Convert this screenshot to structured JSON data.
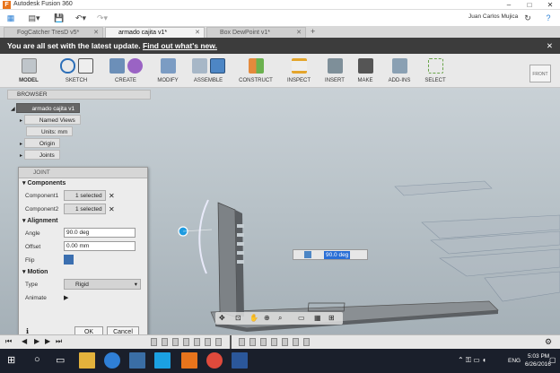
{
  "window": {
    "title": "Autodesk Fusion 360",
    "logo": "F"
  },
  "user": {
    "name": "Juan Carlos Mujica"
  },
  "tabs": [
    {
      "label": "FogCatcher TresD v5*"
    },
    {
      "label": "armado cajita v1*"
    },
    {
      "label": "Box DewPoint v1*"
    }
  ],
  "notification": {
    "text": "You are all set with the latest update.",
    "link": "Find out what's new."
  },
  "toolbar": {
    "model": "MODEL",
    "groups": [
      "SKETCH",
      "CREATE",
      "MODIFY",
      "ASSEMBLE",
      "CONSTRUCT",
      "INSPECT",
      "INSERT",
      "MAKE",
      "ADD-INS",
      "SELECT"
    ],
    "viewcube": "FRONT"
  },
  "browser": {
    "title": "BROWSER",
    "root": "armado cajita v1",
    "items": [
      "Named Views",
      "Units: mm",
      "Origin",
      "Joints"
    ]
  },
  "joint": {
    "title": "JOINT",
    "components_label": "Components",
    "component1_label": "Component1",
    "component1_value": "1 selected",
    "component2_label": "Component2",
    "component2_value": "1 selected",
    "alignment_label": "Alignment",
    "angle_label": "Angle",
    "angle_value": "90.0 deg",
    "offset_label": "Offset",
    "offset_value": "0.00 mm",
    "flip_label": "Flip",
    "motion_label": "Motion",
    "type_label": "Type",
    "type_value": "Rigid",
    "animate_label": "Animate",
    "ok": "OK",
    "cancel": "Cancel"
  },
  "viewport": {
    "angle_input": "90.0 deg"
  },
  "taskbar": {
    "lang": "ENG",
    "time": "5:03 PM",
    "date": "6/26/2016"
  },
  "colors": {
    "accent": "#e8741c",
    "notif": "#3c3c3c",
    "taskbar": "#1a1f2b",
    "manip": "#1e9be0"
  }
}
